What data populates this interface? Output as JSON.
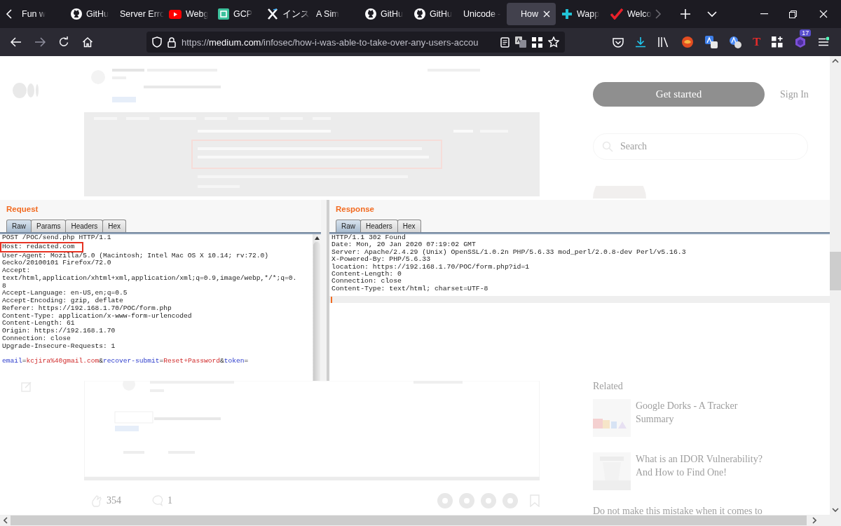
{
  "tabs": [
    {
      "label": "Fun w",
      "kind": "none",
      "selected": false
    },
    {
      "label": "GitHu",
      "kind": "round-logo",
      "selected": false
    },
    {
      "label": "Server Erro",
      "kind": "none",
      "selected": false
    },
    {
      "label": "Webg",
      "kind": "play",
      "selected": false
    },
    {
      "label": "GCP",
      "kind": "square-logo",
      "selected": false
    },
    {
      "label": "インス",
      "kind": "x-logo",
      "selected": false
    },
    {
      "label": "A Sim",
      "kind": "none",
      "selected": false
    },
    {
      "label": "GitHu",
      "kind": "round-logo",
      "selected": false
    },
    {
      "label": "GitHu",
      "kind": "round-logo",
      "selected": false
    },
    {
      "label": "Unicode -",
      "kind": "none",
      "selected": false
    },
    {
      "label": "How",
      "kind": "none",
      "selected": true
    },
    {
      "label": "Wapp",
      "kind": "cross-logo",
      "selected": false
    },
    {
      "label": "Welco",
      "kind": "check",
      "selected": false
    }
  ],
  "address_bar": {
    "scheme": "https://",
    "host": "medium.com",
    "path": "/infosec/how-i-was-able-to-take-over-any-users-accou"
  },
  "toolbar": {
    "extension_letter": "T",
    "badge": "17"
  },
  "page": {
    "get_started": "Get started",
    "sign_in": "Sign In",
    "search": {
      "placeholder": "Search"
    },
    "claps": "354",
    "responses": "1",
    "related": {
      "title": "Related",
      "items": [
        {
          "title": "Google Dorks - A Tracker",
          "subtitle": "Summary"
        },
        {
          "title": "What is an IDOR Vulnerability?",
          "subtitle": "And How to Find One!"
        },
        {
          "title": "Do not make this mistake when it comes to"
        }
      ]
    }
  },
  "burp": {
    "request": {
      "title": "Request",
      "tabs": [
        {
          "label": "Raw",
          "selected": true
        },
        {
          "label": "Params",
          "selected": false
        },
        {
          "label": "Headers",
          "selected": false
        },
        {
          "label": "Hex",
          "selected": false
        }
      ],
      "lines": [
        {
          "text": "POST /POC/send.php HTTP/1.1",
          "highlighted": false
        },
        {
          "text": "Host: redacted.com",
          "highlighted": true
        },
        {
          "text": "User-Agent: Mozilla/5.0 (Macintosh; Intel Mac OS X 10.14; rv:72.0)",
          "highlighted": false
        },
        {
          "text": "Gecko/20100101 Firefox/72.0",
          "highlighted": false
        },
        {
          "text": "Accept:",
          "highlighted": false
        },
        {
          "text": "text/html,application/xhtml+xml,application/xml;q=0.9,image/webp,*/*;q=0.",
          "highlighted": false
        },
        {
          "text": "8",
          "highlighted": false
        },
        {
          "text": "Accept-Language: en-US,en;q=0.5",
          "highlighted": false
        },
        {
          "text": "Accept-Encoding: gzip, deflate",
          "highlighted": false
        },
        {
          "text": "Referer: https://192.168.1.70/POC/form.php",
          "highlighted": false
        },
        {
          "text": "Content-Type: application/x-www-form-urlencoded",
          "highlighted": false
        },
        {
          "text": "Content-Length: 61",
          "highlighted": false
        },
        {
          "text": "Origin: https://192.168.1.70",
          "highlighted": false
        },
        {
          "text": "Connection: close",
          "highlighted": false
        },
        {
          "text": "Upgrade-Insecure-Requests: 1",
          "highlighted": false
        }
      ],
      "body": [
        {
          "text": "email",
          "kind": "name"
        },
        {
          "text": "=",
          "kind": "sep"
        },
        {
          "text": "kcjira%40gmail.com",
          "kind": "value"
        },
        {
          "text": "&",
          "kind": "sep"
        },
        {
          "text": "recover-submit",
          "kind": "name"
        },
        {
          "text": "=",
          "kind": "sep"
        },
        {
          "text": "Reset+Password",
          "kind": "value"
        },
        {
          "text": "&",
          "kind": "sep"
        },
        {
          "text": "token",
          "kind": "name"
        },
        {
          "text": "=",
          "kind": "sep"
        }
      ]
    },
    "response": {
      "title": "Response",
      "tabs": [
        {
          "label": "Raw",
          "selected": true
        },
        {
          "label": "Headers",
          "selected": false
        },
        {
          "label": "Hex",
          "selected": false
        }
      ],
      "lines": [
        {
          "text": "HTTP/1.1 302 Found",
          "highlighted": false
        },
        {
          "text": "Date: Mon, 20 Jan 2020 07:19:02 GMT",
          "highlighted": false
        },
        {
          "text": "Server: Apache/2.4.29 (Unix) OpenSSL/1.0.2n PHP/5.6.33 mod_perl/2.0.8-dev Perl/v5.16.3",
          "highlighted": false
        },
        {
          "text": "X-Powered-By: PHP/5.6.33",
          "highlighted": false
        },
        {
          "text": "location: https://192.168.1.70/POC/form.php?id=1",
          "highlighted": false
        },
        {
          "text": "Content-Length: 0",
          "highlighted": false
        },
        {
          "text": "Connection: close",
          "highlighted": false
        },
        {
          "text": "Content-Type: text/html; charset=UTF-8",
          "highlighted": false
        }
      ]
    }
  }
}
